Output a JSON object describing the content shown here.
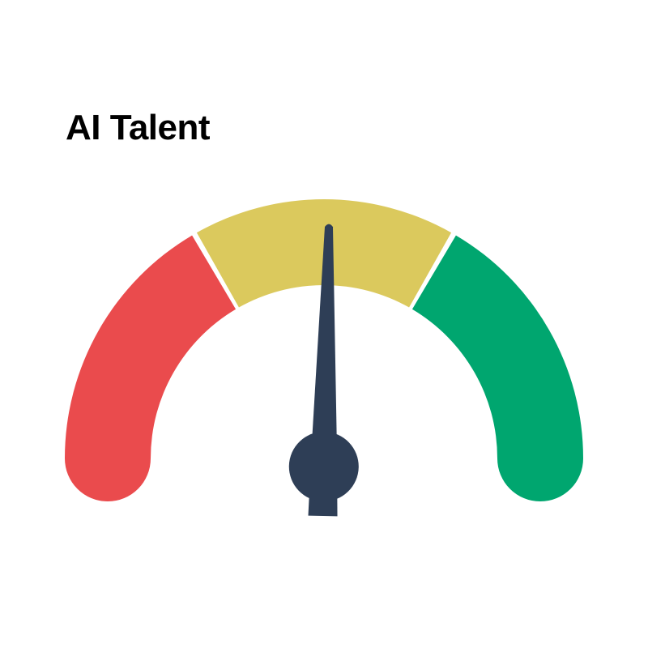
{
  "chart_data": {
    "type": "gauge",
    "title": "AI Talent",
    "range": [
      0,
      3
    ],
    "value": 1.52,
    "bands": [
      {
        "from": 0,
        "to": 1,
        "color": "#ea4b4d"
      },
      {
        "from": 1,
        "to": 2,
        "color": "#dbc95d"
      },
      {
        "from": 2,
        "to": 3,
        "color": "#00a66f"
      }
    ],
    "needle_color": "#2e3e56",
    "rounded_ends": true
  }
}
